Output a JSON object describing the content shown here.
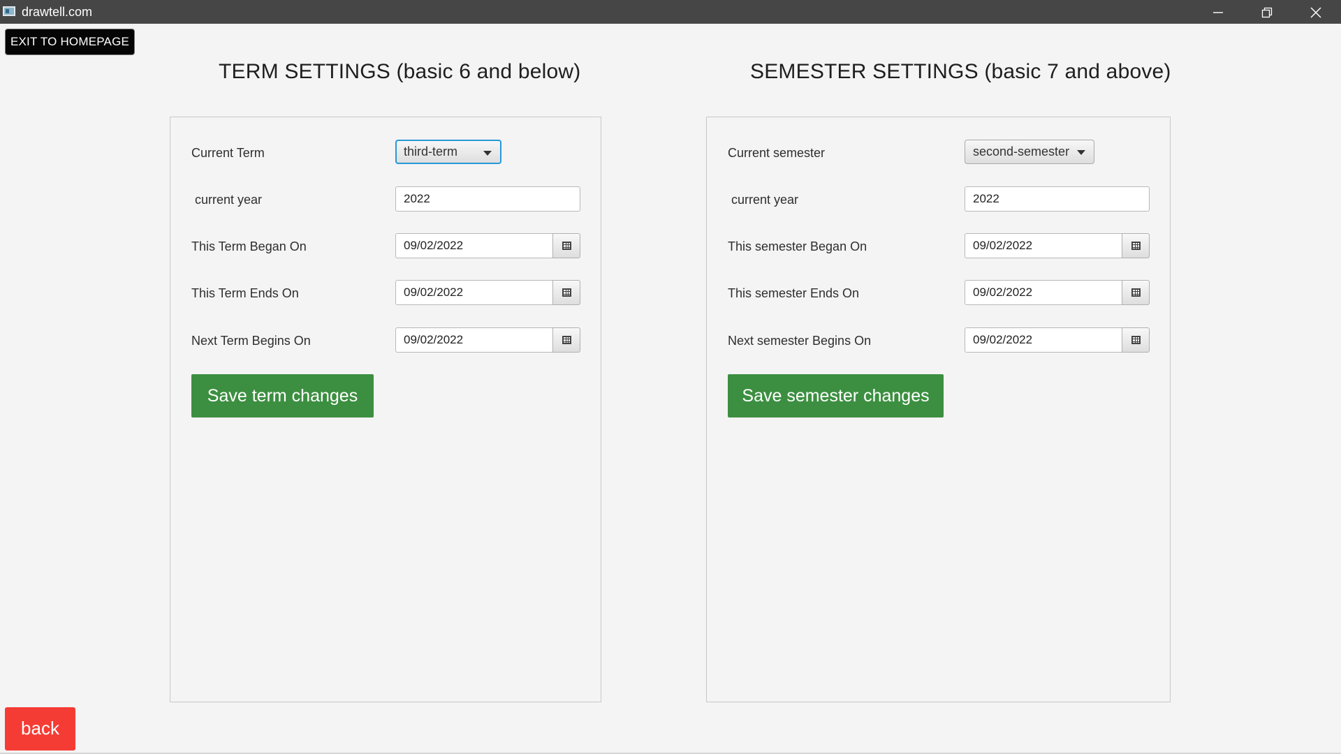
{
  "window": {
    "title": "drawtell.com",
    "controls": [
      "minimize-icon",
      "restore-icon",
      "close-icon"
    ]
  },
  "header": {
    "exit_label": "EXIT TO HOMEPAGE"
  },
  "term_settings": {
    "title": "TERM SETTINGS (basic 6 and below)",
    "current_label": "Current Term",
    "current_value": "third-term",
    "year_label": "current year",
    "year_value": "2022",
    "began_label": "This Term Began On",
    "began_value": "09/02/2022",
    "ends_label": "This Term Ends On",
    "ends_value": "09/02/2022",
    "next_label": "Next Term Begins On",
    "next_value": "09/02/2022",
    "save_label": "Save term changes"
  },
  "semester_settings": {
    "title": "SEMESTER SETTINGS (basic 7 and above)",
    "current_label": "Current semester",
    "current_value": "second-semester",
    "year_label": "current year",
    "year_value": "2022",
    "began_label": "This semester Began On",
    "began_value": "09/02/2022",
    "ends_label": "This semester Ends On",
    "ends_value": "09/02/2022",
    "next_label": "Next semester Begins On",
    "next_value": "09/02/2022",
    "save_label": "Save semester changes"
  },
  "footer": {
    "back_label": "back"
  },
  "colors": {
    "title_bar": "#464646",
    "save_green": "#3c8f40",
    "back_red": "#f53c34",
    "focus_blue": "#2798d9",
    "background": "#f4f4f4"
  }
}
